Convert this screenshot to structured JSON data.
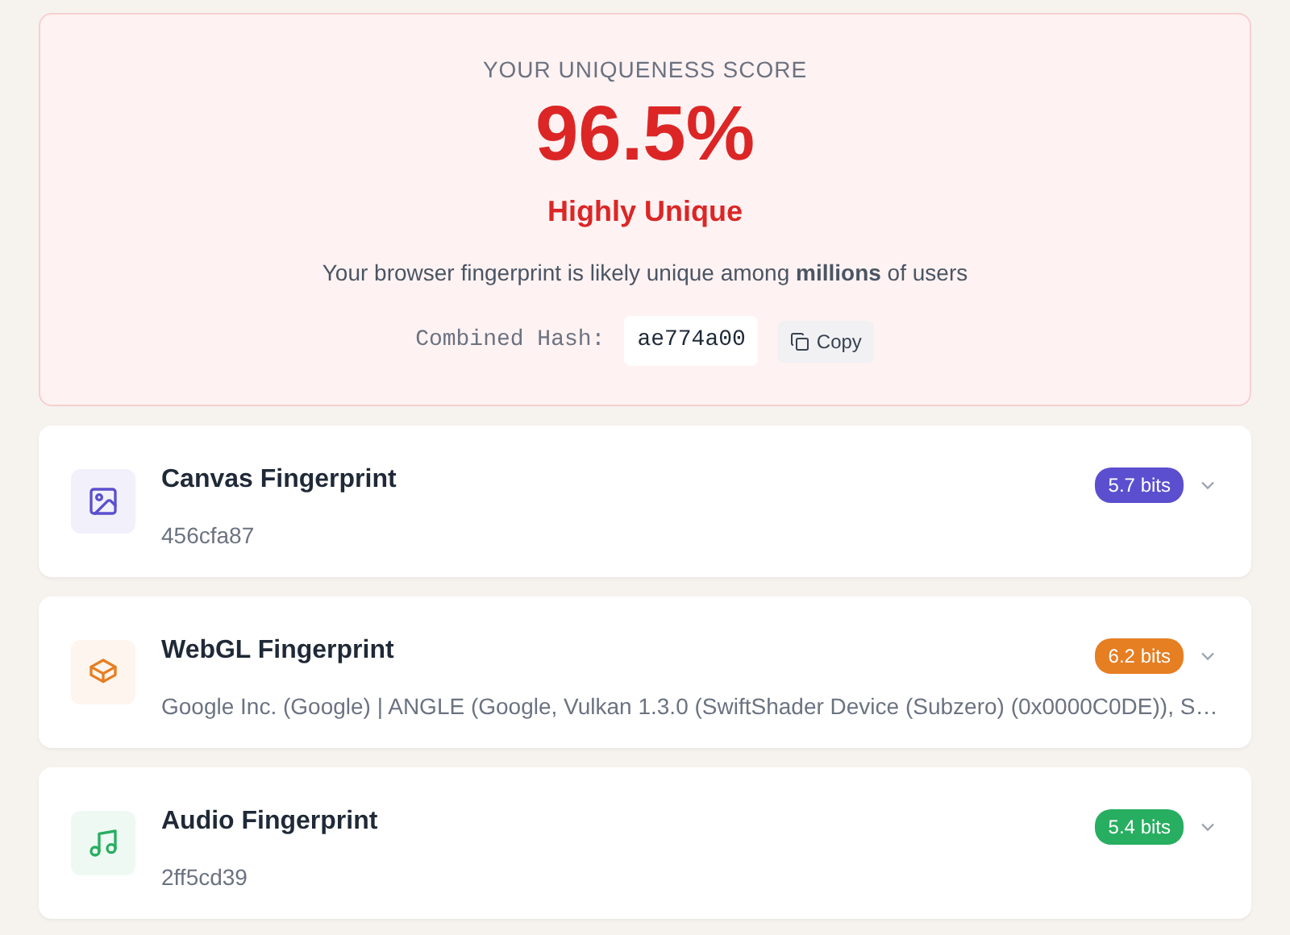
{
  "score": {
    "label": "YOUR UNIQUENESS SCORE",
    "value": "96.5%",
    "verdict": "Highly Unique",
    "description": "Your browser fingerprint is likely unique among **millions** of users",
    "hash_label": "Combined Hash:",
    "hash": "ae774a00",
    "copy_button": "Copy"
  },
  "fingerprints": [
    {
      "kind": "image",
      "title": "Canvas Fingerprint",
      "bits": "5.7 bits",
      "color": "#5b4fcf",
      "value": "456cfa87"
    },
    {
      "kind": "cube",
      "title": "WebGL Fingerprint",
      "bits": "6.2 bits",
      "color": "#e67e22",
      "value": "Google Inc. (Google) | ANGLE (Google, Vulkan 1.3.0 (SwiftShader Device (Subzero) (0x0000C0DE)), S…"
    },
    {
      "kind": "music",
      "title": "Audio Fingerprint",
      "bits": "5.4 bits",
      "color": "#27ae60",
      "value": "2ff5cd39"
    }
  ]
}
